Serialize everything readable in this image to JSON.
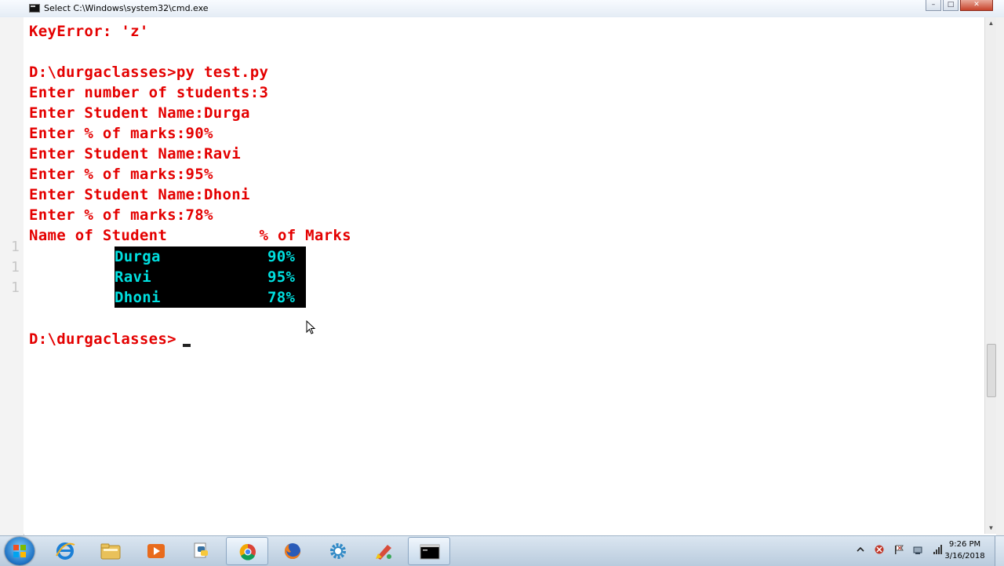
{
  "window": {
    "title": "Select C:\\Windows\\system32\\cmd.exe",
    "minimize": "–",
    "maximize": "□",
    "close": "✕"
  },
  "console": {
    "lines": [
      "KeyError: 'z'",
      "",
      "D:\\durgaclasses>py test.py",
      "Enter number of students:3",
      "Enter Student Name:Durga",
      "Enter % of marks:90%",
      "Enter Student Name:Ravi",
      "Enter % of marks:95%",
      "Enter Student Name:Dhoni",
      "Enter % of marks:78%",
      "Name of Student          % of Marks"
    ],
    "selected_rows": [
      {
        "name": "Durga",
        "marks": "90%"
      },
      {
        "name": "Ravi",
        "marks": "95%"
      },
      {
        "name": "Dhoni",
        "marks": "78%"
      }
    ],
    "prompt": "D:\\durgaclasses>"
  },
  "taskbar": {
    "apps": [
      {
        "name": "internet-explorer",
        "icon": "ie-icon"
      },
      {
        "name": "file-explorer",
        "icon": "folder-icon"
      },
      {
        "name": "media-player",
        "icon": "media-player-icon"
      },
      {
        "name": "python",
        "icon": "python-icon"
      },
      {
        "name": "chrome",
        "icon": "chrome-icon"
      },
      {
        "name": "firefox",
        "icon": "firefox-icon"
      },
      {
        "name": "settings",
        "icon": "gear-icon"
      },
      {
        "name": "editor",
        "icon": "editor-icon"
      },
      {
        "name": "cmd",
        "icon": "cmd-icon"
      }
    ],
    "clock_time": "9:26 PM",
    "clock_date": "3/16/2018"
  },
  "colors": {
    "console_text": "#e40000",
    "selection_bg": "#000000",
    "selection_text": "#00e0e0",
    "console_bg": "#ffffff"
  }
}
